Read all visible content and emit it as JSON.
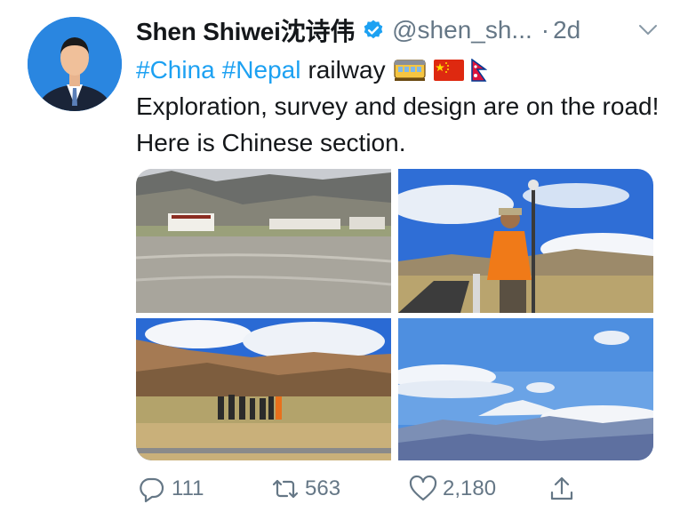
{
  "author": {
    "name": "Shen Shiwei沈诗伟",
    "handle": "@shen_sh...",
    "separator": "·",
    "time": "2d",
    "verified": true
  },
  "tweet": {
    "hashtags": [
      "#China",
      "#Nepal"
    ],
    "line1_word": "railway",
    "body": "Exploration, survey and design are on the road! Here is Chinese section.",
    "emojis": [
      "tram-car-emoji",
      "china-flag-emoji",
      "nepal-flag-emoji"
    ]
  },
  "media": {
    "photos": [
      "village-valley-photo",
      "surveyor-photo",
      "team-on-plain-photo",
      "snow-peak-photo"
    ]
  },
  "actions": {
    "reply_count": "111",
    "retweet_count": "563",
    "like_count": "2,180"
  },
  "colors": {
    "link": "#1da1f2",
    "secondary": "#657786",
    "text": "#14171a"
  }
}
